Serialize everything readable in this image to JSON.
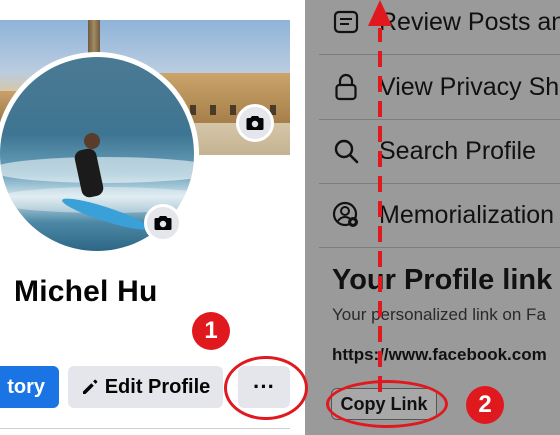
{
  "profile": {
    "name": "Michel Hu",
    "buttons": {
      "story_partial": "tory",
      "edit_profile": "Edit Profile",
      "more": "···"
    }
  },
  "menu": {
    "items": [
      {
        "label": "Review Posts and",
        "icon": "review-posts-icon"
      },
      {
        "label": "View Privacy Sho",
        "icon": "lock-icon"
      },
      {
        "label": "Search Profile",
        "icon": "search-icon"
      },
      {
        "label": "Memorialization",
        "icon": "memorialization-settings-icon"
      }
    ],
    "profile_link": {
      "title": "Your Profile link",
      "subtitle": "Your personalized link on Fa",
      "url": "https://www.facebook.com",
      "copy_label": "Copy Link"
    }
  },
  "annotations": {
    "step1": "1",
    "step2": "2",
    "color": "#e0191f"
  },
  "colors": {
    "primary_blue": "#1b74e4",
    "button_gray": "#e4e6eb",
    "overlay_gray": "#9a9a9a"
  }
}
